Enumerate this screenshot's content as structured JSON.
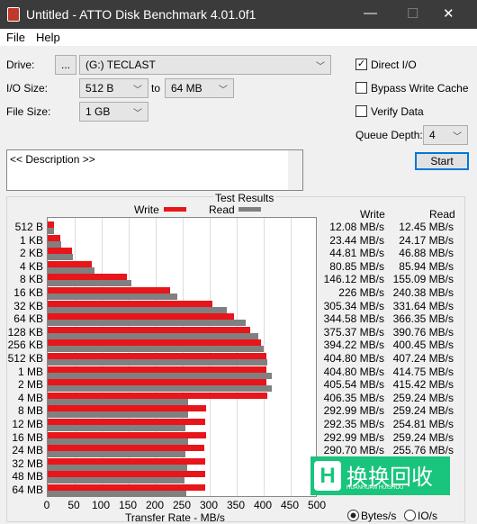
{
  "window": {
    "title": "Untitled - ATTO Disk Benchmark 4.01.0f1"
  },
  "menu": [
    "File",
    "Help"
  ],
  "drive": {
    "label": "Drive:",
    "browse": "...",
    "value": "(G:) TECLAST"
  },
  "io_size": {
    "label": "I/O Size:",
    "from": "512 B",
    "to_label": "to",
    "to": "64 MB"
  },
  "file_size": {
    "label": "File Size:",
    "value": "1 GB"
  },
  "options": {
    "direct_io": {
      "label": "Direct I/O",
      "checked": true
    },
    "bypass": {
      "label": "Bypass Write Cache",
      "checked": false
    },
    "verify": {
      "label": "Verify Data",
      "checked": false
    }
  },
  "queue_depth": {
    "label": "Queue Depth:",
    "value": "4"
  },
  "start_label": "Start",
  "description": "<< Description >>",
  "results": {
    "title": "Test Results",
    "write_header": "Write",
    "read_header": "Read",
    "rows": [
      {
        "size": "512 B",
        "write": "12.08 MB/s",
        "read": "12.45 MB/s"
      },
      {
        "size": "1 KB",
        "write": "23.44 MB/s",
        "read": "24.17 MB/s"
      },
      {
        "size": "2 KB",
        "write": "44.81 MB/s",
        "read": "46.88 MB/s"
      },
      {
        "size": "4 KB",
        "write": "80.85 MB/s",
        "read": "85.94 MB/s"
      },
      {
        "size": "8 KB",
        "write": "146.12 MB/s",
        "read": "155.09 MB/s"
      },
      {
        "size": "16 KB",
        "write": "226 MB/s",
        "read": "240.38 MB/s"
      },
      {
        "size": "32 KB",
        "write": "305.34 MB/s",
        "read": "331.64 MB/s"
      },
      {
        "size": "64 KB",
        "write": "344.58 MB/s",
        "read": "366.35 MB/s"
      },
      {
        "size": "128 KB",
        "write": "375.37 MB/s",
        "read": "390.76 MB/s"
      },
      {
        "size": "256 KB",
        "write": "394.22 MB/s",
        "read": "400.45 MB/s"
      },
      {
        "size": "512 KB",
        "write": "404.80 MB/s",
        "read": "407.24 MB/s"
      },
      {
        "size": "1 MB",
        "write": "404.80 MB/s",
        "read": "414.75 MB/s"
      },
      {
        "size": "2 MB",
        "write": "405.54 MB/s",
        "read": "415.42 MB/s"
      },
      {
        "size": "4 MB",
        "write": "406.35 MB/s",
        "read": "259.24 MB/s"
      },
      {
        "size": "8 MB",
        "write": "292.99 MB/s",
        "read": "259.24 MB/s"
      },
      {
        "size": "12 MB",
        "write": "292.35 MB/s",
        "read": "254.81 MB/s"
      },
      {
        "size": "16 MB",
        "write": "292.99 MB/s",
        "read": "259.24 MB/s"
      },
      {
        "size": "24 MB",
        "write": "290.70 MB/s",
        "read": "255.76 MB/s"
      },
      {
        "size": "32 MB",
        "write": "",
        "read": ""
      },
      {
        "size": "48 MB",
        "write": "",
        "read": ""
      },
      {
        "size": "64 MB",
        "write": "",
        "read": ""
      }
    ]
  },
  "units": {
    "bytes": "Bytes/s",
    "io": "IO/s",
    "selected": "bytes"
  },
  "watermark": {
    "text": "换换回收",
    "sub": "HUANHUAN HUISHOU"
  },
  "chart_data": {
    "type": "bar",
    "orientation": "horizontal",
    "xlabel": "Transfer Rate - MB/s",
    "xlim": [
      0,
      500
    ],
    "xticks": [
      0,
      50,
      100,
      150,
      200,
      250,
      300,
      350,
      400,
      450,
      500
    ],
    "grid": true,
    "legend": "top",
    "categories": [
      "512 B",
      "1 KB",
      "2 KB",
      "4 KB",
      "8 KB",
      "16 KB",
      "32 KB",
      "64 KB",
      "128 KB",
      "256 KB",
      "512 KB",
      "1 MB",
      "2 MB",
      "4 MB",
      "8 MB",
      "12 MB",
      "16 MB",
      "24 MB",
      "32 MB",
      "48 MB",
      "64 MB"
    ],
    "series": [
      {
        "name": "Write",
        "color": "#e8151a",
        "values": [
          12.08,
          23.44,
          44.81,
          80.85,
          146.12,
          226,
          305.34,
          344.58,
          375.37,
          394.22,
          404.8,
          404.8,
          405.54,
          406.35,
          292.99,
          292.35,
          292.99,
          290.7,
          292,
          292,
          292
        ]
      },
      {
        "name": "Read",
        "color": "#808080",
        "values": [
          12.45,
          24.17,
          46.88,
          85.94,
          155.09,
          240.38,
          331.64,
          366.35,
          390.76,
          400.45,
          407.24,
          414.75,
          415.42,
          259.24,
          259.24,
          254.81,
          259.24,
          255.76,
          259,
          254,
          256
        ]
      }
    ]
  }
}
